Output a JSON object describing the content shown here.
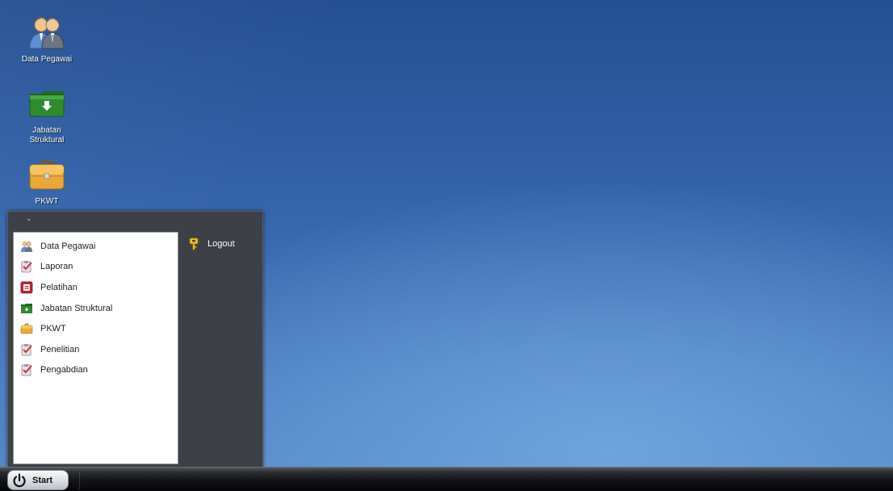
{
  "desktop": {
    "icons": [
      {
        "label": "Data Pegawai",
        "icon": "users-icon"
      },
      {
        "label": "Jabatan Struktural",
        "icon": "green-folder-icon"
      },
      {
        "label": "PKWT",
        "icon": "briefcase-icon"
      }
    ]
  },
  "start_menu": {
    "header": "-",
    "items": [
      {
        "label": "Data Pegawai",
        "icon": "users-icon"
      },
      {
        "label": "Laporan",
        "icon": "clipboard-check-icon"
      },
      {
        "label": "Pelatihan",
        "icon": "red-book-icon"
      },
      {
        "label": "Jabatan Struktural",
        "icon": "green-folder-icon"
      },
      {
        "label": "PKWT",
        "icon": "briefcase-icon"
      },
      {
        "label": "Penelitian",
        "icon": "clipboard-check-icon"
      },
      {
        "label": "Pengabdian",
        "icon": "clipboard-check-icon"
      }
    ],
    "right_items": [
      {
        "label": "Logout",
        "icon": "key-icon"
      }
    ]
  },
  "taskbar": {
    "start_label": "Start"
  },
  "colors": {
    "desktop_top": "#244f93",
    "desktop_bottom": "#5589c9",
    "menu_bg": "#3d4046",
    "taskbar_bg": "#121315"
  }
}
